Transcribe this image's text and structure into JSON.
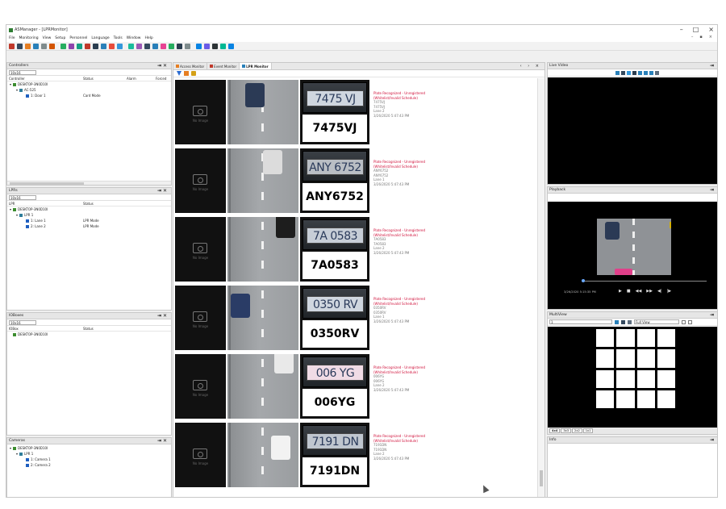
{
  "window": {
    "title": "ASManager - [LPRMonitor]",
    "controls": [
      "–",
      "□",
      "×"
    ],
    "mdi_controls": [
      "–",
      "▪",
      "×"
    ]
  },
  "menu": [
    "File",
    "Monitoring",
    "View",
    "Setup",
    "Personnel",
    "Language",
    "Tools",
    "Window",
    "Help"
  ],
  "toolbar_colors": [
    "#c0392b",
    "#34495e",
    "#e67e22",
    "#2980b9",
    "#7f8c8d",
    "#d35400",
    "#27ae60",
    "#8e44ad",
    "#16a085",
    "#c0392b",
    "#2c3e50",
    "#2980b9",
    "#e74c3c",
    "#3498db",
    "#1abc9c",
    "#9b59b6",
    "#34495e",
    "#2980b9",
    "#e84393",
    "#27ae60",
    "#2c3e50",
    "#7f8c8d",
    "#0984e3",
    "#6c5ce7",
    "#2d3436",
    "#00b894",
    "#0984e3"
  ],
  "panels": {
    "controllers": {
      "title": "Controllers",
      "filter": "10x16",
      "columns": [
        "Controller",
        "Status",
        "Alarm",
        "Forced"
      ],
      "rows": [
        {
          "label": "DESKTOP-3N0D10I",
          "status": "",
          "indent": 0
        },
        {
          "label": "AC-525",
          "status": "",
          "indent": 1
        },
        {
          "label": "1: Door 1",
          "status": "Card Mode",
          "indent": 2
        }
      ]
    },
    "lprs": {
      "title": "LPRs",
      "filter": "10x16",
      "columns": [
        "LPR",
        "Status"
      ],
      "rows": [
        {
          "label": "DESKTOP-3N0D10I",
          "status": "",
          "indent": 0
        },
        {
          "label": "LPR 1",
          "status": "",
          "indent": 1
        },
        {
          "label": "1: Lane 1",
          "status": "LPR Mode",
          "indent": 2
        },
        {
          "label": "2: Lane 2",
          "status": "LPR Mode",
          "indent": 2
        }
      ]
    },
    "ioboxes": {
      "title": "IOBoxes",
      "filter": "10x16",
      "columns": [
        "IOBox",
        "Status"
      ],
      "rows": [
        {
          "label": "DESKTOP-3N0D10I",
          "status": "",
          "indent": 0
        }
      ]
    },
    "cameras": {
      "title": "Cameras",
      "rows": [
        {
          "label": "DESKTOP-3N0D10I",
          "indent": 0
        },
        {
          "label": "LPR 1",
          "indent": 1
        },
        {
          "label": "1: Camera 1",
          "indent": 2
        },
        {
          "label": "2: Camera 2",
          "indent": 2
        }
      ]
    },
    "live_video": {
      "title": "Live Video"
    },
    "playback": {
      "title": "Playback",
      "time": "3/26/2020 5:15:35 PM",
      "progress": 0.0,
      "controls": [
        "▶",
        "■",
        "◀◀",
        "▶▶",
        "◀|",
        "|▶"
      ]
    },
    "multiview": {
      "title": "MultiView",
      "index": "1",
      "view_select": "Full View",
      "layouts": [
        "4x4",
        "3x3",
        "2x2",
        "1x1"
      ],
      "selected_layout": "4x4"
    },
    "info": {
      "title": "Info"
    }
  },
  "center": {
    "tabs": [
      {
        "label": "Access Monitor",
        "active": false
      },
      {
        "label": "Event Monitor",
        "active": false
      },
      {
        "label": "LPR Monitor",
        "active": true
      }
    ],
    "tab_controls": "‹ › ×",
    "no_image_label": "No Image",
    "events": [
      {
        "plate": "7475VJ",
        "plate_image_text": "7475 VJ",
        "plate_bg": "#cfd6df",
        "status": "Plate Recognized - Unregistered",
        "detail": "(Whitelist/Invalid Schedule)",
        "lines": [
          "7475VJ",
          "7475VJ",
          "Lane 2",
          "3/26/2020 5:47:43 PM"
        ],
        "car": {
          "color": "#2b3a55",
          "x": 22,
          "y": 4
        }
      },
      {
        "plate": "ANY6752",
        "plate_image_text": "ANY 6752",
        "plate_bg": "#b9bec4",
        "status": "Plate Recognized - Unregistered",
        "detail": "(Whitelist/Invalid Schedule)",
        "lines": [
          "ANY6752",
          "ANY6752",
          "Lane 1",
          "3/26/2020 5:47:43 PM"
        ],
        "car": {
          "color": "#dcdcdc",
          "x": 44,
          "y": 2
        }
      },
      {
        "plate": "7A0583",
        "plate_image_text": "7A 0583",
        "plate_bg": "#c7ced7",
        "status": "Plate Recognized - Unregistered",
        "detail": "(Whitelist/Invalid Schedule)",
        "lines": [
          "7A0583",
          "7A0583",
          "Lane 2",
          "3/26/2020 5:47:43 PM"
        ],
        "car": {
          "color": "#1d1d1d",
          "x": 60,
          "y": -4
        }
      },
      {
        "plate": "0350RV",
        "plate_image_text": "0350 RV",
        "plate_bg": "#cfd6df",
        "status": "Plate Recognized - Unregistered",
        "detail": "(Whitelist/Invalid Schedule)",
        "lines": [
          "0350RV",
          "0350RV",
          "Lane 1",
          "3/26/2020 5:47:43 PM"
        ],
        "car": {
          "color": "#2a3c66",
          "x": 4,
          "y": 10
        }
      },
      {
        "plate": "006YG",
        "plate_image_text": "006 YG",
        "plate_bg": "#f0dbe6",
        "status": "Plate Recognized - Unregistered",
        "detail": "(Whitelist/Invalid Schedule)",
        "lines": [
          "006YG",
          "006YG",
          "Lane 2",
          "3/26/2020 5:47:43 PM"
        ],
        "car": {
          "color": "#e9e9e9",
          "x": 58,
          "y": -6
        }
      },
      {
        "plate": "7191DN",
        "plate_image_text": "7191 DN",
        "plate_bg": "#bfc6cf",
        "status": "Plate Recognized - Unregistered",
        "detail": "(Whitelist/Invalid Schedule)",
        "lines": [
          "7191DN",
          "7191DN",
          "Lane 2",
          "3/26/2020 5:47:43 PM"
        ],
        "car": {
          "color": "#f2f2f2",
          "x": 54,
          "y": 16
        }
      }
    ]
  }
}
